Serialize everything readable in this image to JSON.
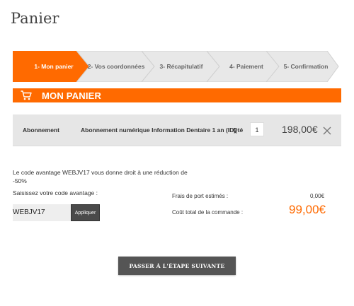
{
  "page": {
    "title": "Panier"
  },
  "steps": [
    {
      "label": "1- Mon panier",
      "active": true
    },
    {
      "label": "2- Vos coordonnées",
      "active": false
    },
    {
      "label": "3- Récapitulatif",
      "active": false
    },
    {
      "label": "4- Paiement",
      "active": false
    },
    {
      "label": "5- Confirmation",
      "active": false
    }
  ],
  "section": {
    "title": "MON PANIER",
    "icon": "cart-icon"
  },
  "cart_item": {
    "type": "Abonnement",
    "description": "Abonnement numérique Information Dentaire 1 an (ID)",
    "qty_label": "Qté",
    "qty": "1",
    "price": "198,00€",
    "remove_icon": "close-icon"
  },
  "promo": {
    "message": "Le code avantage WEBJV17 vous donne droit à une réduction de -50%",
    "label": "Saisissez votre code avantage :",
    "code": "WEBJV17",
    "apply_label": "Appliquer"
  },
  "summary": {
    "shipping_label": "Frais de port estimés :",
    "shipping_value": "0,00€",
    "total_label": "Coût total de la commande :",
    "total_value": "99,00€"
  },
  "actions": {
    "next_label": "PASSER À L'ÉTAPE SUIVANTE"
  },
  "colors": {
    "accent": "#ff6a00",
    "step_inactive": "#e8e8e8",
    "button_dark": "#555555"
  }
}
